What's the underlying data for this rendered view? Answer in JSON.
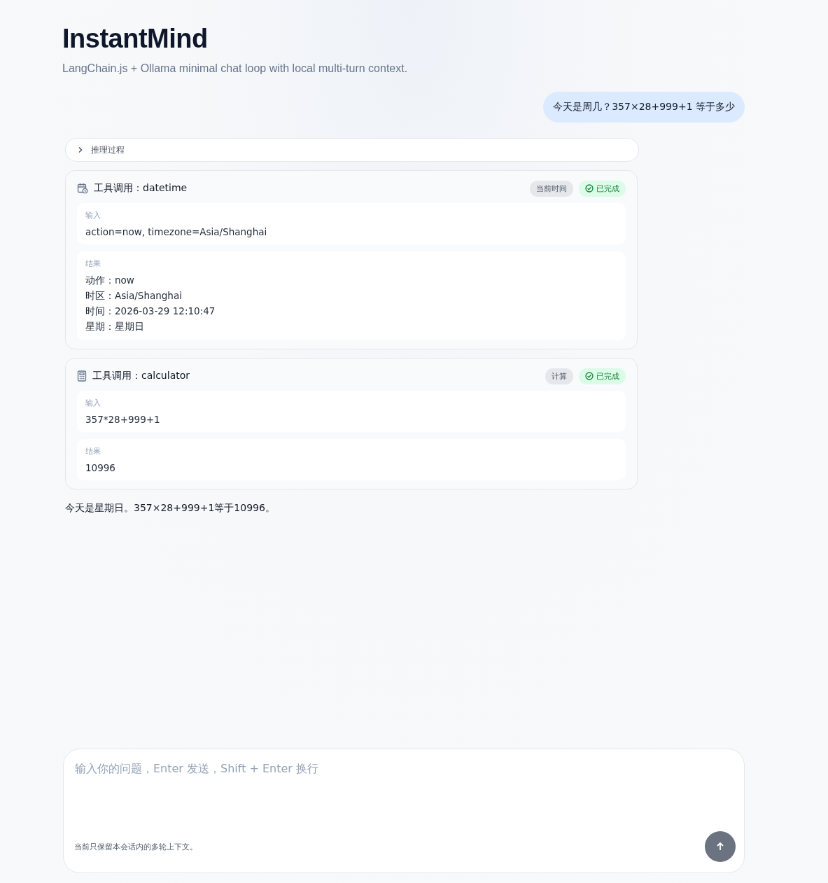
{
  "header": {
    "title": "InstantMind",
    "subtitle": "LangChain.js + Ollama minimal chat loop with local multi-turn context."
  },
  "messages": [
    {
      "kind": "user",
      "text": "今天是周几？357×28+999+1 等于多少"
    },
    {
      "kind": "reasoning",
      "label": "推理过程",
      "expanded": false
    },
    {
      "kind": "tool",
      "title": "工具调用：datetime",
      "tag": "当前时间",
      "status": {
        "kind": "done",
        "label": "已完成"
      },
      "sections": [
        {
          "label": "输入",
          "lines": [
            "action=now, timezone=Asia/Shanghai"
          ]
        },
        {
          "label": "结果",
          "lines": [
            "动作：now",
            "时区：Asia/Shanghai",
            "时间：2026-03-29 12:10:47",
            "星期：星期日"
          ]
        }
      ]
    },
    {
      "kind": "tool",
      "title": "工具调用：calculator",
      "tag": "计算",
      "status": {
        "kind": "done",
        "label": "已完成"
      },
      "sections": [
        {
          "label": "输入",
          "lines": [
            "357*28+999+1"
          ]
        },
        {
          "label": "结果",
          "lines": [
            "10996"
          ]
        }
      ]
    },
    {
      "kind": "assistant",
      "text": "今天是星期日。357×28+999+1等于10996。"
    }
  ],
  "composer": {
    "placeholder": "输入你的问题，Enter 发送，Shift + Enter 换行",
    "note": "当前只保留本会话内的多轮上下文。"
  }
}
